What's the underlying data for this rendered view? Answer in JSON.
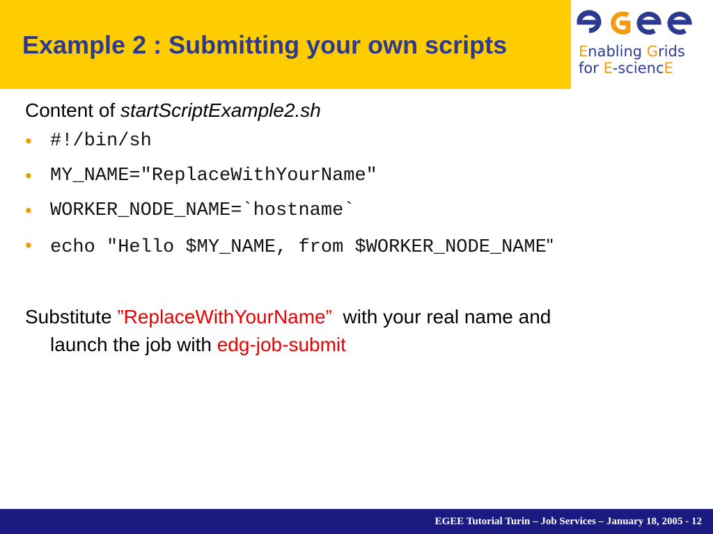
{
  "header": {
    "title": "Example 2 : Submitting your own scripts",
    "background": "#FFCC00",
    "title_color": "#2B3990"
  },
  "logo": {
    "word": "egee",
    "tagline_line1_a": "E",
    "tagline_line1_b": "nabling ",
    "tagline_line1_c": "G",
    "tagline_line1_d": "rids",
    "tagline_line2_a": "for ",
    "tagline_line2_b": "E",
    "tagline_line2_c": "-scienc",
    "tagline_line2_d": "E"
  },
  "content": {
    "intro_prefix": "Content of ",
    "intro_filename": "startScriptExample2.sh",
    "code_lines": [
      "#!/bin/sh",
      "MY_NAME=\"ReplaceWithYourName\"",
      "WORKER_NODE_NAME=`hostname`",
      "echo \"Hello $MY_NAME, from $WORKER_NODE_NAME"
    ],
    "code_line4_tail": "\"",
    "para_prefix": "Substitute ",
    "para_highlight": "”ReplaceWithYourName”",
    "para_middle": "  with your real name and",
    "para_line2_prefix": "launch the job with ",
    "para_command": "edg-job-submit"
  },
  "footer": {
    "text": "EGEE Tutorial Turin – Job Services – January 18, 2005  - 12",
    "background": "#1A1A80"
  },
  "colors": {
    "accent_red": "#E60000",
    "bullet": "#E8A000",
    "logo_blue": "#2B3990",
    "logo_orange": "#F39C12"
  },
  "icons": {
    "logo": "egee-logo-icon"
  }
}
